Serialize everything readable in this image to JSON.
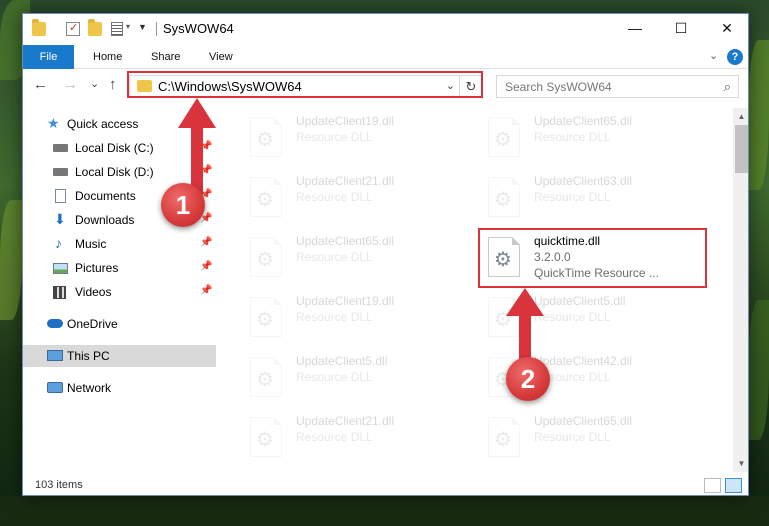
{
  "window": {
    "title": "SysWOW64",
    "minimize_icon": "minimize-icon",
    "maximize_icon": "maximize-icon",
    "close_icon": "close-icon",
    "minimize_glyph": "—",
    "maximize_glyph": "☐",
    "close_glyph": "✕"
  },
  "ribbon": {
    "tabs": [
      "File",
      "Home",
      "Share",
      "View"
    ],
    "expand_glyph": "⌄",
    "help_glyph": "?"
  },
  "navigation": {
    "back_glyph": "←",
    "forward_glyph": "→",
    "recent_glyph": "⌄",
    "up_glyph": "↑",
    "address": "C:\\Windows\\SysWOW64",
    "address_caret": "⌄",
    "refresh_glyph": "↻",
    "search_placeholder": "Search SysWOW64",
    "search_glyph": "⌕"
  },
  "sidebar": {
    "items": [
      {
        "label": "Quick access",
        "icon": "star-icon",
        "pinned": false
      },
      {
        "label": "Local Disk (C:)",
        "icon": "drive-icon",
        "pinned": true
      },
      {
        "label": "Local Disk (D:)",
        "icon": "drive-icon",
        "pinned": true
      },
      {
        "label": "Documents",
        "icon": "document-icon",
        "pinned": true
      },
      {
        "label": "Downloads",
        "icon": "download-icon",
        "pinned": true
      },
      {
        "label": "Music",
        "icon": "music-icon",
        "pinned": true
      },
      {
        "label": "Pictures",
        "icon": "pictures-icon",
        "pinned": true
      },
      {
        "label": "Videos",
        "icon": "videos-icon",
        "pinned": true
      },
      {
        "label": "OneDrive",
        "icon": "cloud-icon",
        "pinned": false
      },
      {
        "label": "This PC",
        "icon": "computer-icon",
        "pinned": false,
        "selected": true
      },
      {
        "label": "Network",
        "icon": "network-icon",
        "pinned": false
      }
    ],
    "pin_glyph": "📌"
  },
  "files": [
    {
      "name": "UpdateClient19.dll",
      "type": "Resource DLL"
    },
    {
      "name": "UpdateClient65.dll",
      "type": "Resource DLL"
    },
    {
      "name": "UpdateClient21.dll",
      "type": "Resource DLL"
    },
    {
      "name": "UpdateClient63.dll",
      "type": "Resource DLL"
    },
    {
      "name": "UpdateClient65.dll",
      "type": "Resource DLL"
    },
    {
      "name": "quicktime.dll",
      "version": "3.2.0.0",
      "description": "QuickTime Resource ...",
      "highlighted": true
    },
    {
      "name": "UpdateClient19.dll",
      "type": "Resource DLL"
    },
    {
      "name": "UpdateClient5.dll",
      "type": "Resource DLL"
    },
    {
      "name": "UpdateClient5.dll",
      "type": "Resource DLL"
    },
    {
      "name": "UpdateClient42.dll",
      "type": "Resource DLL"
    },
    {
      "name": "UpdateClient21.dll",
      "type": "Resource DLL"
    },
    {
      "name": "UpdateClient65.dll",
      "type": "Resource DLL"
    }
  ],
  "file_icon": "dll-gear-icon",
  "gear_glyph": "⚙",
  "scrollbar": {
    "up_glyph": "▲",
    "down_glyph": "▼"
  },
  "status": {
    "item_count": "103 items"
  },
  "annotations": {
    "step1": "1",
    "step2": "2",
    "color": "#d9343c"
  }
}
